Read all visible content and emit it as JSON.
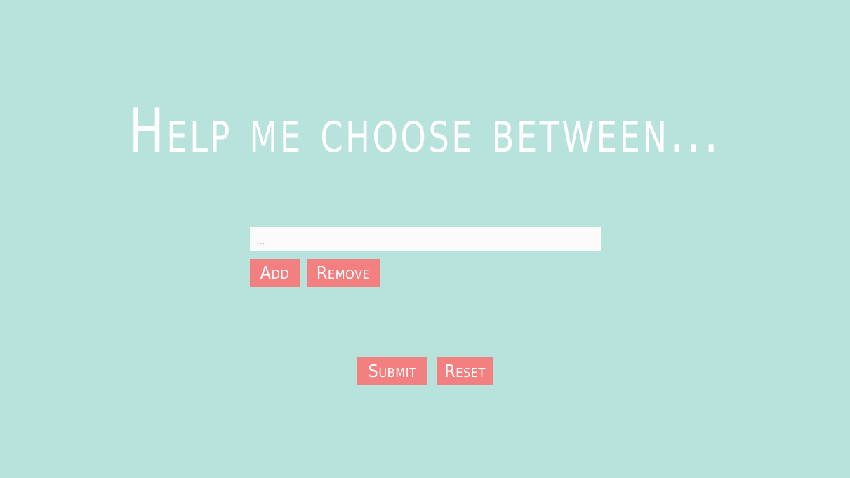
{
  "header": {
    "title": "Help me choose between..."
  },
  "form": {
    "option_input": {
      "value": "",
      "placeholder": "..."
    },
    "add_label": "Add",
    "remove_label": "Remove",
    "submit_label": "Submit",
    "reset_label": "Reset"
  },
  "colors": {
    "background": "#b8e2dc",
    "button": "#f38080",
    "text": "#ffffff",
    "input_background": "#fafafa"
  }
}
